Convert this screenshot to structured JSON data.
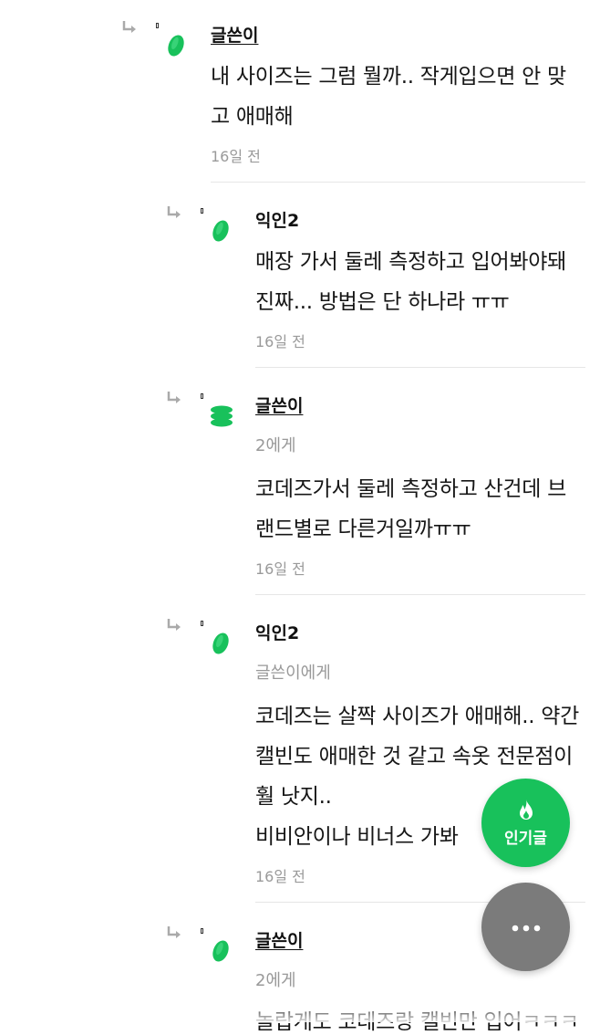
{
  "comments": [
    {
      "author": "글쓴이",
      "lines": [
        "내 사이즈는 그럼 뭘까.. 작게입으면 안 맞",
        "고 애매해"
      ],
      "time": "16일 전"
    },
    {
      "author": "익인2",
      "lines": [
        "매장 가서 둘레 측정하고 입어봐야돼",
        "진짜... 방법은 단 하나라 ㅠㅠ"
      ],
      "time": "16일 전"
    },
    {
      "author": "글쓴이",
      "mention": "2에게",
      "lines": [
        "코데즈가서 둘레 측정하고 산건데 브",
        "랜드별로 다른거일까ㅠㅠ"
      ],
      "time": "16일 전"
    },
    {
      "author": "익인2",
      "mention": "글쓴이에게",
      "lines": [
        "코데즈는 살짝 사이즈가 애매해.. 약간",
        "캘빈도 애매한 것 같고 속옷 전문점이",
        "훨 낫지..",
        "비비안이나 비너스 가봐"
      ],
      "time": "16일 전"
    },
    {
      "author": "글쓴이",
      "mention": "2에게",
      "lines": [
        "놀랍게도 코데즈랑 캘빈만 입어ㅋㅋㅋ"
      ]
    }
  ],
  "fab": {
    "popular_label": "인기글",
    "popular_icon": "fire-icon",
    "more_icon": "more-dots-icon"
  },
  "colors": {
    "accent_green": "#18c15b",
    "fab_gray": "#7b7b7b",
    "timestamp_gray": "#9a9a9a"
  }
}
